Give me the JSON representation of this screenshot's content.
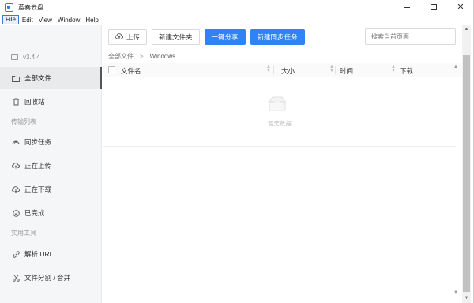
{
  "window": {
    "title": "蓝奏云盘"
  },
  "menu": [
    "File",
    "Edit",
    "View",
    "Window",
    "Help"
  ],
  "sidebar": {
    "version": "v3.4.4",
    "items": [
      {
        "label": "全部文件",
        "icon": "folder-icon",
        "active": true
      },
      {
        "label": "回收站",
        "icon": "trash-icon"
      }
    ],
    "section_transfer": "传输列表",
    "transfer_items": [
      {
        "label": "同步任务",
        "icon": "sync-icon"
      },
      {
        "label": "正在上传",
        "icon": "upload-cloud-icon"
      },
      {
        "label": "正在下载",
        "icon": "download-cloud-icon"
      },
      {
        "label": "已完成",
        "icon": "check-circle-icon"
      }
    ],
    "section_tools": "实用工具",
    "tool_items": [
      {
        "label": "解析 URL",
        "icon": "link-icon"
      },
      {
        "label": "文件分割 / 合并",
        "icon": "scissors-icon"
      }
    ]
  },
  "toolbar": {
    "upload": "上传",
    "new_folder": "新建文件夹",
    "share": "一键分享",
    "new_sync": "新建同步任务"
  },
  "search": {
    "placeholder": "搜索当前页面"
  },
  "breadcrumb": {
    "root": "全部文件",
    "current": "Windows"
  },
  "table": {
    "columns": [
      "文件名",
      "大小",
      "时间",
      "下载"
    ],
    "empty_text": "暂无数据"
  },
  "colors": {
    "primary": "#2f83f5",
    "sidebar_bg": "#f5f6f7"
  }
}
